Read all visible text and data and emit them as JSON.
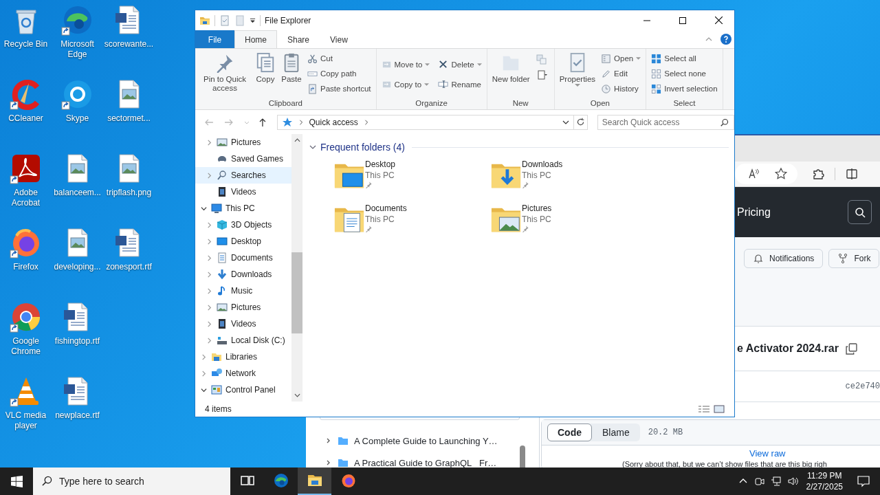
{
  "desktop_icons": [
    {
      "label": "Recycle Bin",
      "shortcut": false
    },
    {
      "label": "CCleaner",
      "shortcut": true
    },
    {
      "label": "Adobe Acrobat",
      "shortcut": true
    },
    {
      "label": "Firefox",
      "shortcut": true
    },
    {
      "label": "Google Chrome",
      "shortcut": true
    },
    {
      "label": "VLC media player",
      "shortcut": true
    },
    {
      "label": "Microsoft Edge",
      "shortcut": true
    },
    {
      "label": "Skype",
      "shortcut": true
    },
    {
      "label": "balanceem...",
      "shortcut": false
    },
    {
      "label": "developing...",
      "shortcut": false
    },
    {
      "label": "fishingtop.rtf",
      "shortcut": false
    },
    {
      "label": "newplace.rtf",
      "shortcut": false
    },
    {
      "label": "scorewante...",
      "shortcut": false
    },
    {
      "label": "sectormet...",
      "shortcut": false
    },
    {
      "label": "tripflash.png",
      "shortcut": false
    },
    {
      "label": "zonesport.rtf",
      "shortcut": false
    }
  ],
  "browser": {
    "header_link": "Pricing",
    "repo_buttons": [
      {
        "label": "Notifications"
      },
      {
        "label": "Fork"
      }
    ],
    "file_name": "e Activator 2024.rar",
    "commit": "ce2e740",
    "file_tree": [
      {
        "label": "A Complete Guide to Launching Y…",
        "expanded": false
      },
      {
        "label": "A Practical Guide to GraphQL_ Fr…",
        "expanded": false
      }
    ],
    "view_tabs": [
      {
        "label": "Code",
        "selected": true
      },
      {
        "label": "Blame",
        "selected": false
      }
    ],
    "file_size": "20.2 MB",
    "view_raw": "View raw",
    "notice": "(Sorry about that, but we can’t show files that are this big righ"
  },
  "explorer": {
    "title": "File Explorer",
    "tabs": [
      {
        "label": "File",
        "kind": "menu",
        "selected": false
      },
      {
        "label": "Home",
        "kind": "tab",
        "selected": true
      },
      {
        "label": "Share",
        "kind": "tab",
        "selected": false
      },
      {
        "label": "View",
        "kind": "tab",
        "selected": false
      }
    ],
    "ribbon": [
      {
        "label": "Clipboard",
        "items": [
          {
            "label": "Pin to Quick access",
            "kind": "large",
            "dropdown": false
          },
          {
            "label": "Copy",
            "kind": "large",
            "dropdown": false
          },
          {
            "label": "Paste",
            "kind": "large",
            "dropdown": false
          },
          {
            "label": "Cut",
            "kind": "small",
            "dropdown": false
          },
          {
            "label": "Copy path",
            "kind": "small",
            "dropdown": false
          },
          {
            "label": "Paste shortcut",
            "kind": "small",
            "dropdown": false
          }
        ]
      },
      {
        "label": "Organize",
        "items": [
          {
            "label": "Move to",
            "kind": "small",
            "dropdown": true
          },
          {
            "label": "Copy to",
            "kind": "small",
            "dropdown": true
          },
          {
            "label": "Delete",
            "kind": "small",
            "dropdown": true
          },
          {
            "label": "Rename",
            "kind": "small",
            "dropdown": false
          }
        ]
      },
      {
        "label": "New",
        "items": [
          {
            "label": "New folder",
            "kind": "large",
            "dropdown": false
          }
        ]
      },
      {
        "label": "Open",
        "items": [
          {
            "label": "Properties",
            "kind": "large",
            "dropdown": true
          },
          {
            "label": "Open",
            "kind": "small",
            "dropdown": true
          },
          {
            "label": "Edit",
            "kind": "small",
            "dropdown": false
          },
          {
            "label": "History",
            "kind": "small",
            "dropdown": false
          }
        ]
      },
      {
        "label": "Select",
        "items": [
          {
            "label": "Select all",
            "kind": "small",
            "dropdown": false
          },
          {
            "label": "Select none",
            "kind": "small",
            "dropdown": false
          },
          {
            "label": "Invert selection",
            "kind": "small",
            "dropdown": false
          }
        ]
      }
    ],
    "address": "Quick access",
    "search_placeholder": "Search Quick access",
    "nav_tree": {
      "scrolled": [
        {
          "label": "Pictures",
          "expanded": false,
          "selected": false
        },
        {
          "label": "Saved Games",
          "selected": false
        },
        {
          "label": "Searches",
          "expanded": false,
          "selected": true
        },
        {
          "label": "Videos",
          "selected": false
        }
      ],
      "items": [
        {
          "label": "This PC",
          "expanded": true,
          "selected": false,
          "children": [
            {
              "label": "3D Objects",
              "expanded": false,
              "selected": false
            },
            {
              "label": "Desktop",
              "expanded": false,
              "selected": false
            },
            {
              "label": "Documents",
              "expanded": false,
              "selected": false
            },
            {
              "label": "Downloads",
              "expanded": false,
              "selected": false
            },
            {
              "label": "Music",
              "expanded": false,
              "selected": false
            },
            {
              "label": "Pictures",
              "expanded": false,
              "selected": false
            },
            {
              "label": "Videos",
              "expanded": false,
              "selected": false
            },
            {
              "label": "Local Disk (C:)",
              "expanded": false,
              "selected": false
            }
          ]
        },
        {
          "label": "Libraries",
          "expanded": false,
          "selected": false
        },
        {
          "label": "Network",
          "expanded": false,
          "selected": false
        },
        {
          "label": "Control Panel",
          "expanded": true,
          "selected": false
        }
      ]
    },
    "section": {
      "label": "Frequent folders (4)",
      "expanded": true
    },
    "folders": [
      {
        "name": "Desktop",
        "location": "This PC",
        "pinned": true
      },
      {
        "name": "Downloads",
        "location": "This PC",
        "pinned": true
      },
      {
        "name": "Documents",
        "location": "This PC",
        "pinned": true
      },
      {
        "name": "Pictures",
        "location": "This PC",
        "pinned": true
      }
    ],
    "status": "4 items"
  },
  "taskbar": {
    "search_placeholder": "Type here to search",
    "apps": [
      {
        "active": false
      },
      {
        "active": false
      },
      {
        "active": true
      },
      {
        "active": false
      }
    ],
    "time": "11:29 PM",
    "date": "2/27/2025"
  }
}
